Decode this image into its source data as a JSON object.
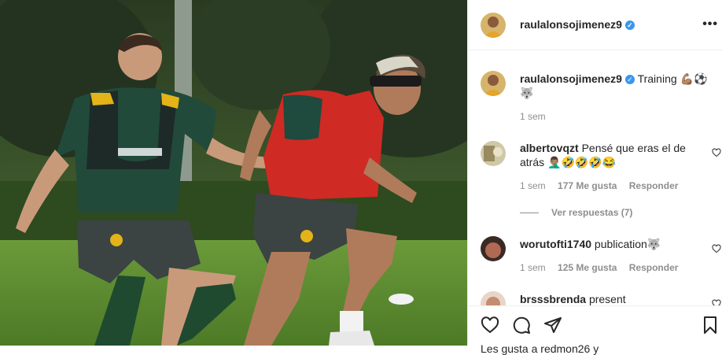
{
  "post": {
    "author": "raulalonsojimenez9",
    "verified": true,
    "caption_text": "Training 💪🏽⚽",
    "caption_extra": "🐺",
    "time": "1 sem"
  },
  "comments": [
    {
      "user": "albertovqzt",
      "text": "Pensé que eras el de atrás 🤦🏽‍♂️🤣🤣🤣😂",
      "time": "1 sem",
      "likes": "177 Me gusta",
      "reply": "Responder",
      "view_replies": "Ver respuestas (7)"
    },
    {
      "user": "worutofti1740",
      "text": "publication🐺",
      "time": "1 sem",
      "likes": "125 Me gusta",
      "reply": "Responder"
    },
    {
      "user": "brsssbrenda",
      "text": "present"
    }
  ],
  "likes_line": "Les gusta a redmon26 y",
  "colors": {
    "verified": "#3897f0",
    "muted": "#8e8e8e",
    "text": "#262626"
  },
  "icons": [
    "more-icon",
    "heart-icon",
    "comment-icon",
    "share-icon",
    "bookmark-icon",
    "verified-icon"
  ]
}
